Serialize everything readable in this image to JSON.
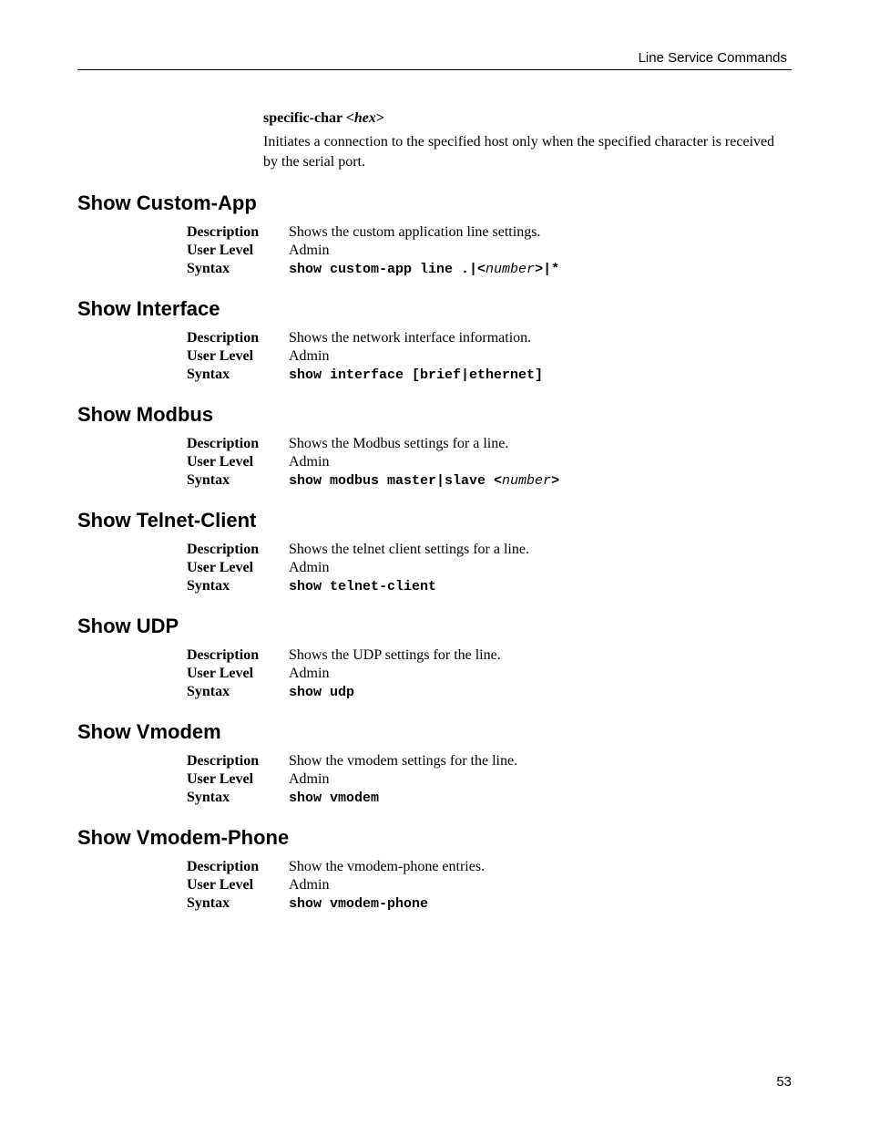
{
  "header": {
    "title": "Line Service Commands"
  },
  "intro_option": {
    "title_bold": "specific-char <",
    "title_italic": "hex",
    "title_close": ">",
    "desc": "Initiates a connection to the specified host only when the specified character is received by the serial port."
  },
  "sections": [
    {
      "title": "Show Custom-App",
      "description": "Shows the custom application line settings.",
      "user_level": "Admin",
      "syntax_pre": "show custom-app line .|<",
      "syntax_ital": "number",
      "syntax_post": ">|*"
    },
    {
      "title": "Show Interface",
      "description": "Shows the network interface information.",
      "user_level": "Admin",
      "syntax_pre": "show interface [brief|ethernet]",
      "syntax_ital": "",
      "syntax_post": ""
    },
    {
      "title": "Show Modbus",
      "description": "Shows the Modbus settings for a line.",
      "user_level": "Admin",
      "syntax_pre": "show modbus master|slave <",
      "syntax_ital": "number",
      "syntax_post": ">"
    },
    {
      "title": "Show Telnet-Client",
      "description": "Shows the telnet client settings for a line.",
      "user_level": "Admin",
      "syntax_pre": "show telnet-client",
      "syntax_ital": "",
      "syntax_post": ""
    },
    {
      "title": "Show UDP",
      "description": "Shows the UDP settings for the line.",
      "user_level": "Admin",
      "syntax_pre": "show udp",
      "syntax_ital": "",
      "syntax_post": ""
    },
    {
      "title": "Show Vmodem",
      "description": "Show the vmodem settings for the line.",
      "user_level": "Admin",
      "syntax_pre": "show vmodem",
      "syntax_ital": "",
      "syntax_post": ""
    },
    {
      "title": "Show Vmodem-Phone",
      "description": "Show the vmodem-phone entries.",
      "user_level": "Admin",
      "syntax_pre": "show vmodem-phone",
      "syntax_ital": "",
      "syntax_post": ""
    }
  ],
  "labels": {
    "description": "Description",
    "user_level": "User Level",
    "syntax": "Syntax"
  },
  "page_number": "53"
}
